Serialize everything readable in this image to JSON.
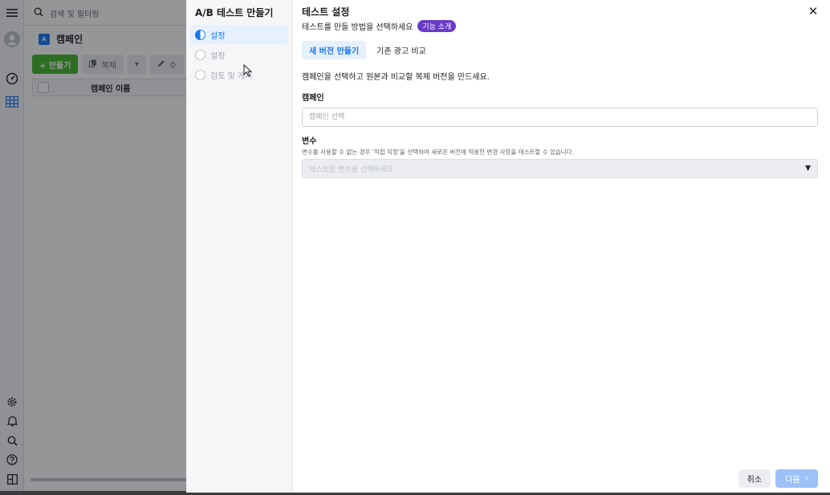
{
  "background_app": {
    "search_placeholder": "검색 및 필터링",
    "page_title": "캠페인",
    "camp_logo_letter": "A",
    "toolbar": {
      "create_label": "+ 만들기",
      "duplicate_label": "복제",
      "edit_label": "수"
    },
    "table": {
      "column_campaign_name": "캠페인 이름"
    },
    "rail_icons": [
      "menu-icon",
      "avatar-icon",
      "dashboard-icon",
      "grid-icon",
      "gear-icon",
      "bell-icon",
      "search-icon",
      "help-icon",
      "panel-icon"
    ]
  },
  "dialog": {
    "steps_title": "A/B 테스트 만들기",
    "steps": [
      {
        "label": "설정",
        "active": true
      },
      {
        "label": "설정",
        "active": false
      },
      {
        "label": "검토 및 게시",
        "active": false
      }
    ],
    "title": "테스트 설정",
    "subtitle": "테스트를 만들 방법을 선택하세요",
    "badge": "기능 소개",
    "close_glyph": "✕",
    "tabs": [
      {
        "label": "새 버전 만들기",
        "active": true
      },
      {
        "label": "기존 광고 비교",
        "active": false
      }
    ],
    "description": "캠페인을 선택하고 원본과 비교할 복제 버전을 만드세요.",
    "campaign_field": {
      "label": "캠페인",
      "value": "",
      "placeholder": "캠페인 선택"
    },
    "variable_field": {
      "label": "변수",
      "help": "변수를 사용할 수 없는 경우 '직접 지정'을 선택하여 새로운 버전에 적용한 변경 사항을 테스트할 수 있습니다.",
      "placeholder": "테스트할 변수를 선택하세요"
    },
    "footer": {
      "cancel_label": "취소",
      "next_label": "다음",
      "next_enabled": false
    }
  },
  "colors": {
    "accent": "#1877f2",
    "badge": "#6a3ac8",
    "create_button": "#42b72a",
    "next_disabled": "#9cc2f7"
  }
}
